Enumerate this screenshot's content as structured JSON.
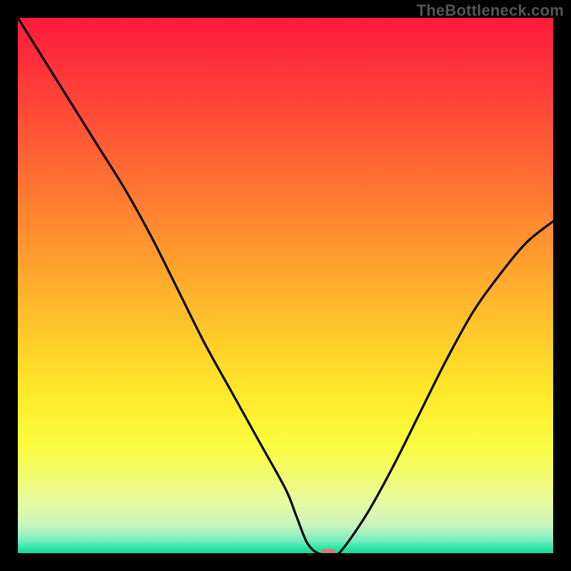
{
  "watermark": "TheBottleneck.com",
  "colors": {
    "frame": "#000000",
    "marker": "#cf7b73",
    "curve": "#000000"
  },
  "gradient_stops": [
    {
      "offset": 0.0,
      "color": "#ff1a3c"
    },
    {
      "offset": 0.08,
      "color": "#ff2f3a"
    },
    {
      "offset": 0.18,
      "color": "#ff4b37"
    },
    {
      "offset": 0.3,
      "color": "#ff6f33"
    },
    {
      "offset": 0.42,
      "color": "#ff952e"
    },
    {
      "offset": 0.55,
      "color": "#ffbd2b"
    },
    {
      "offset": 0.7,
      "color": "#ffe92a"
    },
    {
      "offset": 0.8,
      "color": "#fafd3f"
    },
    {
      "offset": 0.86,
      "color": "#f0fb74"
    },
    {
      "offset": 0.91,
      "color": "#e6f9a6"
    },
    {
      "offset": 0.95,
      "color": "#c6f4bc"
    },
    {
      "offset": 0.975,
      "color": "#7eeec1"
    },
    {
      "offset": 0.99,
      "color": "#2fe6a7"
    },
    {
      "offset": 1.0,
      "color": "#11df98"
    }
  ],
  "chart_data": {
    "type": "line",
    "title": "",
    "xlabel": "",
    "ylabel": "",
    "xlim": [
      0,
      100
    ],
    "ylim": [
      0,
      100
    ],
    "grid": false,
    "legend": false,
    "marker": {
      "x": 58,
      "y": 0
    },
    "x": [
      0,
      5,
      10,
      15,
      20,
      25,
      30,
      35,
      40,
      45,
      50,
      52,
      54,
      56,
      58,
      60,
      65,
      70,
      75,
      80,
      85,
      90,
      95,
      100
    ],
    "values": [
      100,
      92,
      84,
      76,
      68,
      59,
      49,
      39,
      30,
      21,
      12,
      7,
      2,
      0,
      0,
      0,
      7,
      16,
      26,
      36,
      45,
      52,
      58,
      62
    ]
  }
}
